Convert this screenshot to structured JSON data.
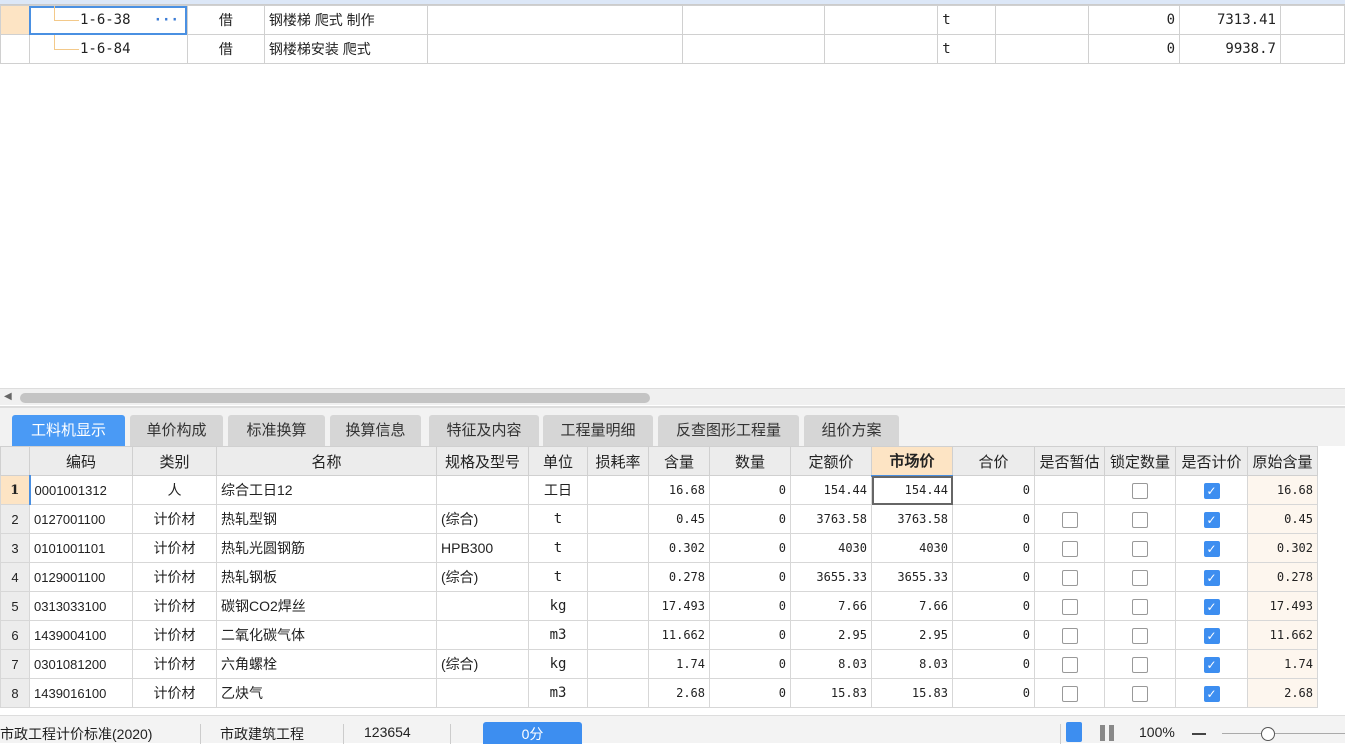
{
  "top_table": {
    "rows": [
      {
        "code": "1-6-38",
        "type": "借",
        "name": "钢楼梯 爬式 制作",
        "unit": "t",
        "qty": "0",
        "price": "7313.41",
        "more": "···"
      },
      {
        "code": "1-6-84",
        "type": "借",
        "name": "钢楼梯安装 爬式",
        "unit": "t",
        "qty": "0",
        "price": "9938.7"
      }
    ]
  },
  "tabs": [
    "工料机显示",
    "单价构成",
    "标准换算",
    "换算信息",
    "特征及内容",
    "工程量明细",
    "反查图形工程量",
    "组价方案"
  ],
  "grid": {
    "headers": [
      "编码",
      "类别",
      "名称",
      "规格及型号",
      "单位",
      "损耗率",
      "含量",
      "数量",
      "定额价",
      "市场价",
      "合价",
      "是否暂估",
      "锁定数量",
      "是否计价",
      "原始含量"
    ],
    "rows": [
      {
        "n": "1",
        "code": "0001001312",
        "cat": "人",
        "name": "综合工日12",
        "spec": "",
        "unit": "工日",
        "loss": "",
        "content": "16.68",
        "qty": "0",
        "quota": "154.44",
        "market": "154.44",
        "total": "0",
        "est": null,
        "lock": false,
        "priced": true,
        "orig": "16.68"
      },
      {
        "n": "2",
        "code": "0127001100",
        "cat": "计价材",
        "name": "热轧型钢",
        "spec": "(综合)",
        "unit": "t",
        "loss": "",
        "content": "0.45",
        "qty": "0",
        "quota": "3763.58",
        "market": "3763.58",
        "total": "0",
        "est": false,
        "lock": false,
        "priced": true,
        "orig": "0.45"
      },
      {
        "n": "3",
        "code": "0101001101",
        "cat": "计价材",
        "name": "热轧光圆钢筋",
        "spec": "HPB300",
        "unit": "t",
        "loss": "",
        "content": "0.302",
        "qty": "0",
        "quota": "4030",
        "market": "4030",
        "total": "0",
        "est": false,
        "lock": false,
        "priced": true,
        "orig": "0.302"
      },
      {
        "n": "4",
        "code": "0129001100",
        "cat": "计价材",
        "name": "热轧钢板",
        "spec": "(综合)",
        "unit": "t",
        "loss": "",
        "content": "0.278",
        "qty": "0",
        "quota": "3655.33",
        "market": "3655.33",
        "total": "0",
        "est": false,
        "lock": false,
        "priced": true,
        "orig": "0.278"
      },
      {
        "n": "5",
        "code": "0313033100",
        "cat": "计价材",
        "name": "碳钢CO2焊丝",
        "spec": "",
        "unit": "kg",
        "loss": "",
        "content": "17.493",
        "qty": "0",
        "quota": "7.66",
        "market": "7.66",
        "total": "0",
        "est": false,
        "lock": false,
        "priced": true,
        "orig": "17.493"
      },
      {
        "n": "6",
        "code": "1439004100",
        "cat": "计价材",
        "name": "二氧化碳气体",
        "spec": "",
        "unit": "m3",
        "loss": "",
        "content": "11.662",
        "qty": "0",
        "quota": "2.95",
        "market": "2.95",
        "total": "0",
        "est": false,
        "lock": false,
        "priced": true,
        "orig": "11.662"
      },
      {
        "n": "7",
        "code": "0301081200",
        "cat": "计价材",
        "name": "六角螺栓",
        "spec": "(综合)",
        "unit": "kg",
        "loss": "",
        "content": "1.74",
        "qty": "0",
        "quota": "8.03",
        "market": "8.03",
        "total": "0",
        "est": false,
        "lock": false,
        "priced": true,
        "orig": "1.74"
      },
      {
        "n": "8",
        "code": "1439016100",
        "cat": "计价材",
        "name": "乙炔气",
        "spec": "",
        "unit": "m3",
        "loss": "",
        "content": "2.68",
        "qty": "0",
        "quota": "15.83",
        "market": "15.83",
        "total": "0",
        "est": false,
        "lock": false,
        "priced": true,
        "orig": "2.68"
      }
    ]
  },
  "status": {
    "standard": "市政工程计价标准(2020)",
    "project_type": "市政建筑工程",
    "code": "123654",
    "score": "0分",
    "zoom": "100%"
  }
}
